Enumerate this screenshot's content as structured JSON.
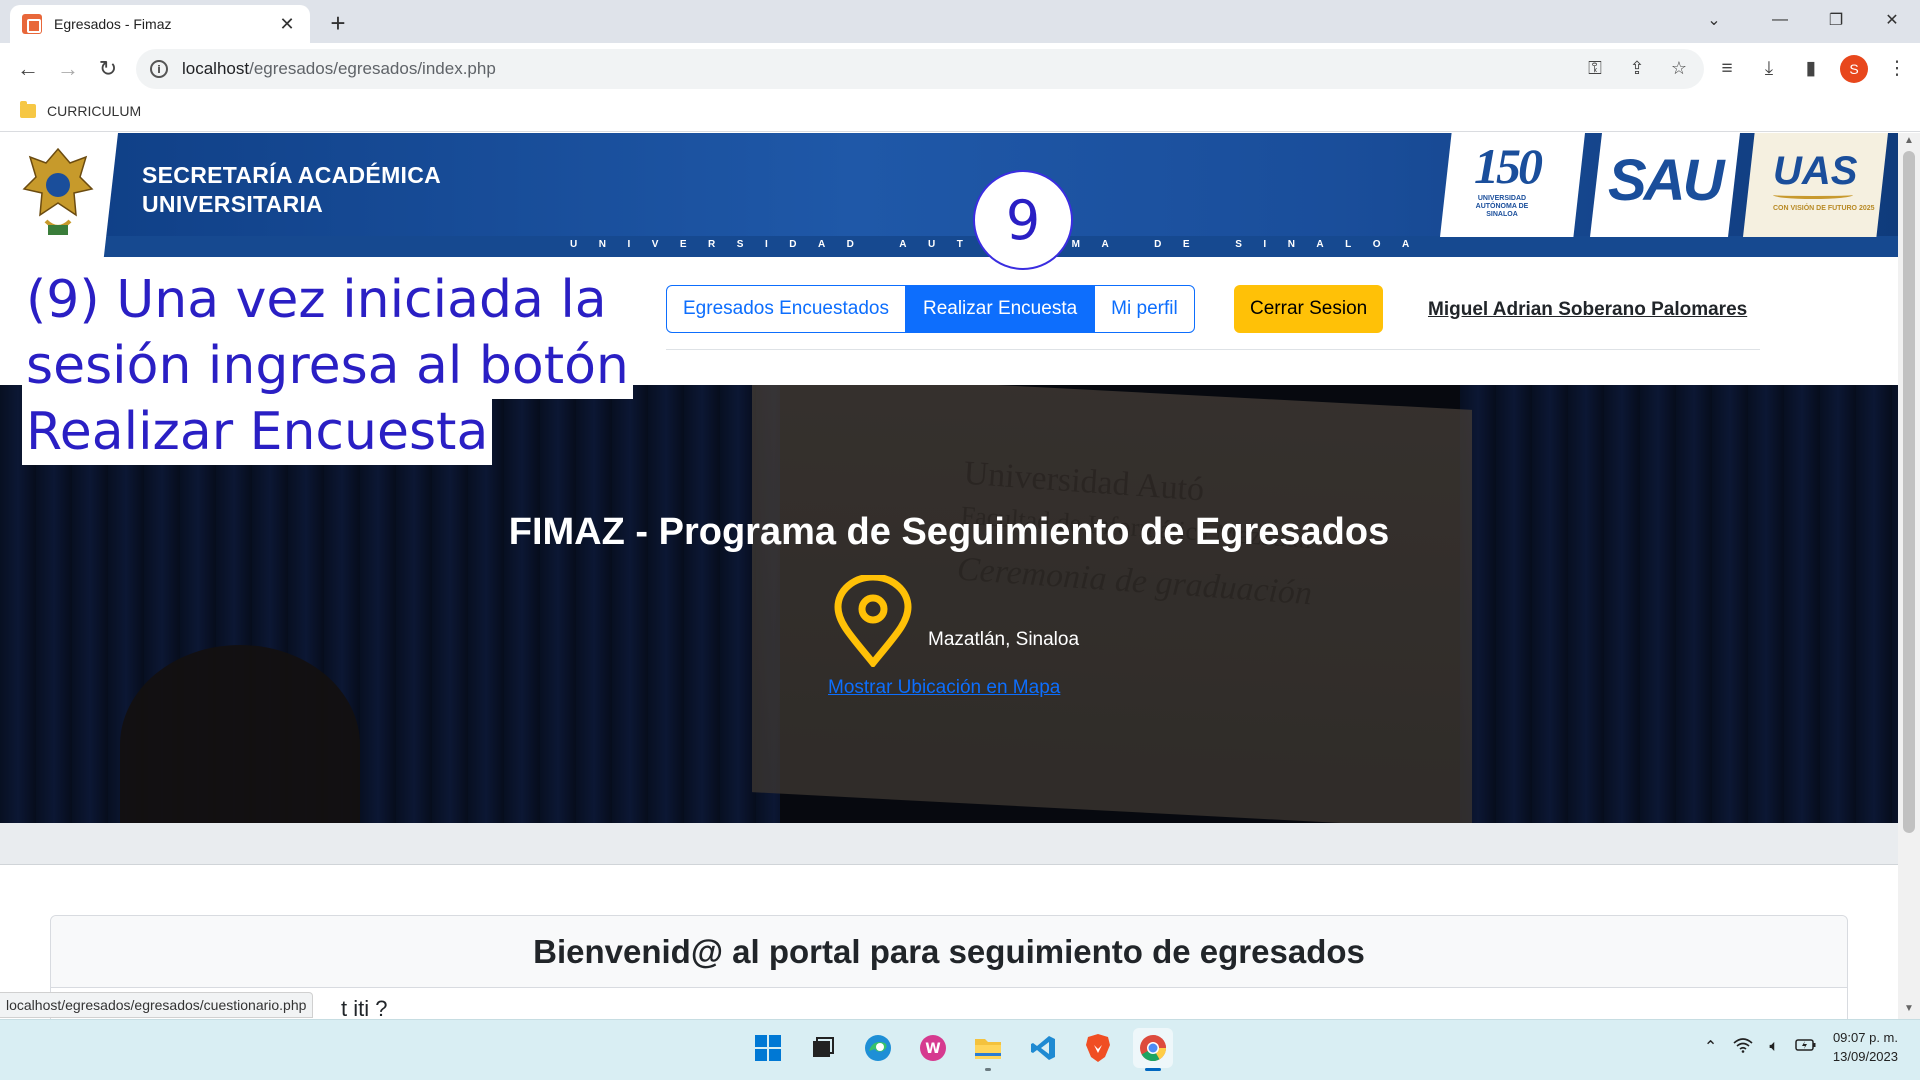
{
  "browser": {
    "tab_title": "Egresados - Fimaz",
    "tab_close": "✕",
    "new_tab": "+",
    "url_host": "localhost",
    "url_path": "/egresados/egresados/index.php",
    "profile_initial": "S",
    "bookmark": "CURRICULUM"
  },
  "header": {
    "secretaria_line1": "SECRETARÍA ACADÉMICA",
    "secretaria_line2": "UNIVERSITARIA",
    "university_strip": "UNIVERSIDAD AUTÓNOMA DE SINALOA",
    "logo_150": "150",
    "logo_150_sub": "UNIVERSIDAD AUTÓNOMA DE SINALOA",
    "logo_sau": "SAU",
    "logo_uas": "UAS",
    "logo_uas_sub": "CON VISIÓN DE FUTURO 2025"
  },
  "step_number": "9",
  "annotation": {
    "line1": "(9) Una vez iniciada la",
    "line2": "sesión ingresa al botón",
    "line3": "Realizar Encuesta"
  },
  "nav": {
    "egresados_encuestados": "Egresados Encuestados",
    "realizar_encuesta": "Realizar Encuesta",
    "mi_perfil": "Mi perfil",
    "cerrar_sesion": "Cerrar Sesion",
    "user_name": "Miguel Adrian Soberano Palomares"
  },
  "hero": {
    "title": "FIMAZ - Programa de Seguimiento de Egresados",
    "location": "Mazatlán, Sinaloa",
    "map_link": "Mostrar Ubicación en Mapa",
    "screen_text_1": "Universidad Autó",
    "screen_text_2": "Facultad de Informática Mazatlán",
    "screen_text_3": "Ceremonia de graduación"
  },
  "card": {
    "title": "Bienvenid@ al portal para seguimiento de egresados",
    "partial_text": "t iti ?"
  },
  "status_bar_url": "localhost/egresados/egresados/cuestionario.php",
  "taskbar": {
    "time": "09:07 p. m.",
    "date": "13/09/2023"
  },
  "colors": {
    "primary": "#0d6efd",
    "warning": "#ffc107",
    "annotation": "#2a1fc4",
    "banner": "#1f58a8"
  }
}
